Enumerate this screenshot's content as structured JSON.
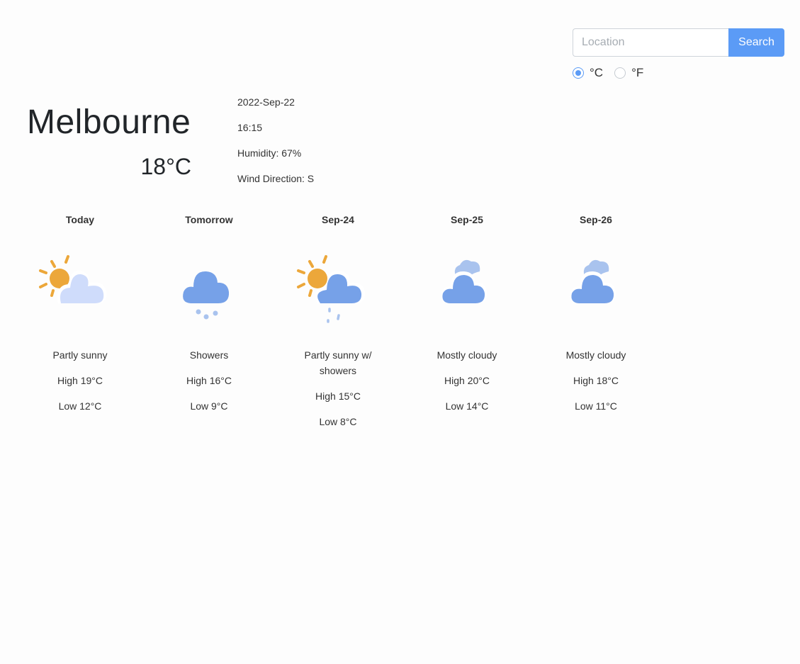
{
  "search": {
    "placeholder": "Location",
    "button_label": "Search"
  },
  "units": {
    "celsius_label": "°C",
    "fahrenheit_label": "°F",
    "selected": "celsius"
  },
  "current": {
    "city": "Melbourne",
    "temperature": "18°C",
    "date": "2022-Sep-22",
    "time": "16:15",
    "humidity": "Humidity: 67%",
    "wind": "Wind Direction: S"
  },
  "forecast": [
    {
      "day": "Today",
      "icon": "partly-sunny-icon",
      "condition": "Partly sunny",
      "high": "High 19°C",
      "low": "Low 12°C"
    },
    {
      "day": "Tomorrow",
      "icon": "showers-icon",
      "condition": "Showers",
      "high": "High 16°C",
      "low": "Low 9°C"
    },
    {
      "day": "Sep-24",
      "icon": "partly-sunny-showers-icon",
      "condition": "Partly sunny w/ showers",
      "high": "High 15°C",
      "low": "Low 8°C"
    },
    {
      "day": "Sep-25",
      "icon": "mostly-cloudy-icon",
      "condition": "Mostly cloudy",
      "high": "High 20°C",
      "low": "Low 14°C"
    },
    {
      "day": "Sep-26",
      "icon": "mostly-cloudy-icon",
      "condition": "Mostly cloudy",
      "high": "High 18°C",
      "low": "Low 11°C"
    }
  ],
  "colors": {
    "accent": "#5b9bf6",
    "sun": "#eca73a",
    "cloud_dark": "#76a1e8",
    "cloud_light": "#cfdcfb",
    "rain": "#a9c3ee"
  }
}
